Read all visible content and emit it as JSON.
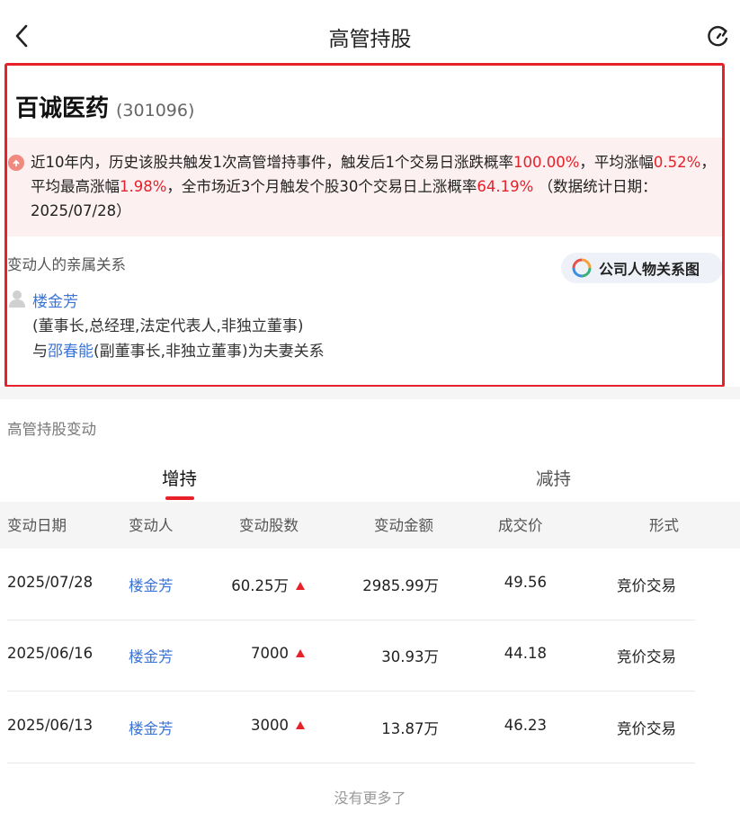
{
  "header": {
    "title": "高管持股"
  },
  "stock": {
    "name": "百诚医药",
    "code": "(301096)"
  },
  "stats": {
    "t1": "近10年内，历史该股共触发1次高管增持事件，触发后1个交易日涨跌概率",
    "v1": "100.00%",
    "t2": "，平均涨幅",
    "v2": "0.52%",
    "t3": "，平均最高涨幅",
    "v3": "1.98%",
    "t4": "，全市场近3个月触发个股30个交易日上涨概率",
    "v4": "64.19%",
    "t5": " （数据统计日期：2025/07/28）"
  },
  "kin": {
    "label": "变动人的亲属关系",
    "relation_button": "公司人物关系图",
    "person_name": "楼金芳",
    "person_role": "(董事长,总经理,法定代表人,非独立董事)",
    "spouse_prefix": "与",
    "spouse_name": "邵春能",
    "spouse_suffix": "(副董事长,非独立董事)为夫妻关系"
  },
  "section": {
    "title": "高管持股变动"
  },
  "tabs": {
    "add": "增持",
    "reduce": "减持"
  },
  "table": {
    "headers": [
      "变动日期",
      "变动人",
      "变动股数",
      "变动金额",
      "成交价",
      "形式"
    ],
    "rows": [
      {
        "date": "2025/07/28",
        "person": "楼金芳",
        "shares": "60.25万",
        "amount": "2985.99万",
        "price": "49.56",
        "form": "竞价交易"
      },
      {
        "date": "2025/06/16",
        "person": "楼金芳",
        "shares": "7000",
        "amount": "30.93万",
        "price": "44.18",
        "form": "竞价交易"
      },
      {
        "date": "2025/06/13",
        "person": "楼金芳",
        "shares": "3000",
        "amount": "13.87万",
        "price": "46.23",
        "form": "竞价交易"
      }
    ]
  },
  "footer": {
    "no_more": "没有更多了"
  },
  "colors": {
    "accent_red": "#e8202a",
    "link_blue": "#3a74d8"
  }
}
